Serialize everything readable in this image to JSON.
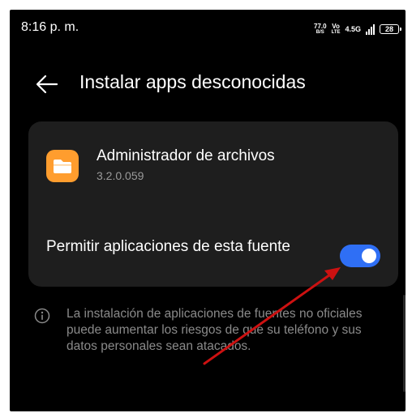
{
  "status_bar": {
    "time": "8:16 p. m.",
    "speed_value": "77.0",
    "speed_unit": "B/S",
    "volte_top": "Vo",
    "volte_bottom": "LTE",
    "network": "4.5G",
    "battery": "28"
  },
  "header": {
    "back_icon": "arrow-left-icon",
    "title": "Instalar apps desconocidas"
  },
  "app": {
    "icon": "folder-icon",
    "name": "Administrador de archivos",
    "version": "3.2.0.059"
  },
  "permission": {
    "label": "Permitir aplicaciones de esta fuente",
    "enabled": true
  },
  "info": {
    "icon": "info-icon",
    "text": "La instalación de aplicaciones de fuentes no oficiales puede aumentar los riesgos de que su teléfono y sus datos personales sean atacados."
  },
  "colors": {
    "background": "#000000",
    "card": "#1e1e1e",
    "accent": "#2f6ff5",
    "folder": "#ff9d2e",
    "annotation_arrow": "#cc1111"
  }
}
